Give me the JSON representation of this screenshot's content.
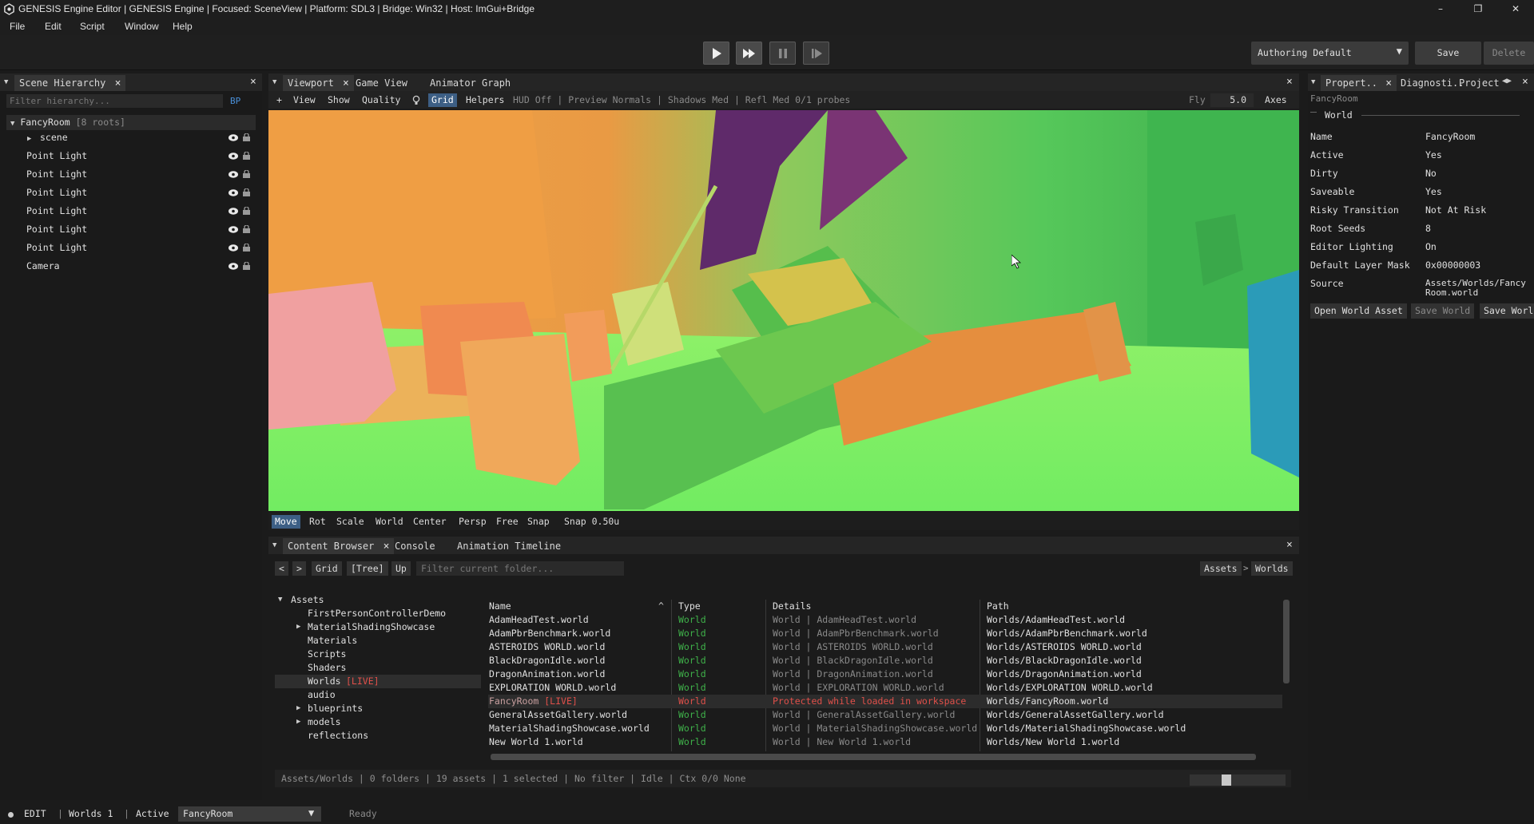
{
  "window": {
    "title": "GENESIS Engine Editor | GENESIS Engine | Focused: SceneView | Platform: SDL3 | Bridge: Win32 | Host: ImGui+Bridge",
    "controls": {
      "minimize": "–",
      "maximize": "❐",
      "close": "✕"
    }
  },
  "menu": [
    "File",
    "Edit",
    "Script",
    "Window",
    "Help"
  ],
  "toolbar": {
    "play_icons": [
      "play-icon",
      "fast-forward-icon",
      "pause-icon",
      "step-icon"
    ],
    "profile": "Authoring Default",
    "profile_arrow": "▼",
    "save": "Save",
    "delete": "Delete"
  },
  "hierarchy": {
    "tab": "Scene Hierarchy",
    "filter_placeholder": "Filter hierarchy...",
    "bp": "BP",
    "root": "FancyRoom",
    "root_count": "[8 roots]",
    "items": [
      {
        "label": "scene",
        "expandable": true
      },
      {
        "label": "Point Light"
      },
      {
        "label": "Point Light"
      },
      {
        "label": "Point Light"
      },
      {
        "label": "Point Light"
      },
      {
        "label": "Point Light"
      },
      {
        "label": "Point Light"
      },
      {
        "label": "Camera"
      }
    ]
  },
  "viewport": {
    "tabs": [
      "Viewport",
      "Game View",
      "Animator Graph"
    ],
    "toolbar": {
      "plus": "+",
      "view": "View",
      "show": "Show",
      "quality": "Quality",
      "grid": "Grid",
      "helpers": "Helpers",
      "hud_status": "HUD Off | Preview Normals | Shadows Med | Refl Med 0/1 probes",
      "fly": "Fly",
      "fly_speed": "5.0",
      "axes": "Axes"
    },
    "bottom_tools": [
      "Move",
      "Rot",
      "Scale",
      "World",
      "Center",
      "Persp",
      "Free",
      "Snap",
      "Snap 0.50u"
    ]
  },
  "content_browser": {
    "tabs": [
      "Content Browser",
      "Console",
      "Animation Timeline"
    ],
    "nav": {
      "back": "<",
      "forward": ">",
      "grid": "Grid",
      "tree": "[Tree]",
      "up": "Up"
    },
    "filter_placeholder": "Filter current folder...",
    "breadcrumb": [
      "Assets",
      ">",
      "Worlds"
    ],
    "tree": [
      {
        "label": "Assets",
        "level": 0,
        "expander": "▼"
      },
      {
        "label": "FirstPersonControllerDemo",
        "level": 1,
        "expander": ""
      },
      {
        "label": "MaterialShadingShowcase",
        "level": 1,
        "expander": "▶"
      },
      {
        "label": "Materials",
        "level": 1,
        "expander": ""
      },
      {
        "label": "Scripts",
        "level": 1,
        "expander": ""
      },
      {
        "label": "Shaders",
        "level": 1,
        "expander": ""
      },
      {
        "label": "Worlds",
        "level": 1,
        "expander": "",
        "tag": "[LIVE]",
        "selected": true
      },
      {
        "label": "audio",
        "level": 1,
        "expander": ""
      },
      {
        "label": "blueprints",
        "level": 1,
        "expander": "▶"
      },
      {
        "label": "models",
        "level": 1,
        "expander": "▶"
      },
      {
        "label": "reflections",
        "level": 1,
        "expander": ""
      }
    ],
    "columns": [
      "Name",
      "Type",
      "Details",
      "Path"
    ],
    "sort_indicator": "^",
    "rows": [
      {
        "name": "AdamHeadTest.world",
        "type": "World",
        "details": "World | AdamHeadTest.world",
        "path": "Worlds/AdamHeadTest.world"
      },
      {
        "name": "AdamPbrBenchmark.world",
        "type": "World",
        "details": "World | AdamPbrBenchmark.world",
        "path": "Worlds/AdamPbrBenchmark.world"
      },
      {
        "name": "ASTEROIDS WORLD.world",
        "type": "World",
        "details": "World | ASTEROIDS WORLD.world",
        "path": "Worlds/ASTEROIDS WORLD.world"
      },
      {
        "name": "BlackDragonIdle.world",
        "type": "World",
        "details": "World | BlackDragonIdle.world",
        "path": "Worlds/BlackDragonIdle.world"
      },
      {
        "name": "DragonAnimation.world",
        "type": "World",
        "details": "World | DragonAnimation.world",
        "path": "Worlds/DragonAnimation.world"
      },
      {
        "name": "EXPLORATION WORLD.world",
        "type": "World",
        "details": "World | EXPLORATION WORLD.world",
        "path": "Worlds/EXPLORATION WORLD.world"
      },
      {
        "name": "FancyRoom",
        "tag": "[LIVE]",
        "type": "World",
        "details": "Protected while loaded in workspace",
        "path": "Worlds/FancyRoom.world",
        "live": true
      },
      {
        "name": "GeneralAssetGallery.world",
        "type": "World",
        "details": "World | GeneralAssetGallery.world",
        "path": "Worlds/GeneralAssetGallery.world"
      },
      {
        "name": "MaterialShadingShowcase.world",
        "type": "World",
        "details": "World | MaterialShadingShowcase.world",
        "path": "Worlds/MaterialShadingShowcase.world"
      },
      {
        "name": "New World 1.world",
        "type": "World",
        "details": "World | New World 1.world",
        "path": "Worlds/New World 1.world"
      }
    ],
    "status": "Assets/Worlds | 0 folders | 19 assets | 1 selected | No filter | Idle | Ctx 0/0 None"
  },
  "properties": {
    "tabs": [
      "Propert..",
      "Diagnosti..",
      "Project"
    ],
    "object": "FancyRoom",
    "section": "World",
    "rows": [
      {
        "key": "Name",
        "value": "FancyRoom"
      },
      {
        "key": "Active",
        "value": "Yes"
      },
      {
        "key": "Dirty",
        "value": "No"
      },
      {
        "key": "Saveable",
        "value": "Yes"
      },
      {
        "key": "Risky Transition",
        "value": "Not At Risk"
      },
      {
        "key": "Root Seeds",
        "value": "8"
      },
      {
        "key": "Editor Lighting",
        "value": "On"
      },
      {
        "key": "Default Layer Mask",
        "value": "0x00000003"
      },
      {
        "key": "Source",
        "value": "Assets/Worlds/FancyRoom.world"
      }
    ],
    "buttons": [
      "Open World Asset",
      "Save World",
      "Save Worl"
    ]
  },
  "statusbar": {
    "mode": "EDIT",
    "worlds": "Worlds 1",
    "active": "Active",
    "world_select": "FancyRoom",
    "ready": "Ready"
  },
  "colors": {
    "accent": "#3d5f85",
    "world_type": "#3fb24a",
    "live": "#e0504a",
    "muted": "#8a8a8a"
  }
}
